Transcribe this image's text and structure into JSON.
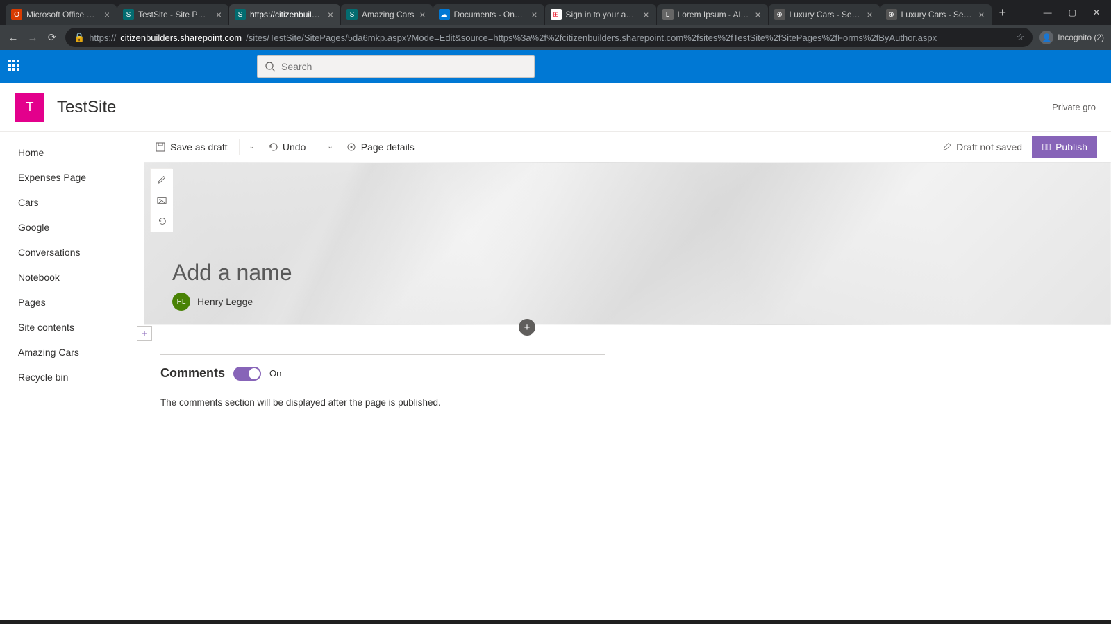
{
  "browser": {
    "tabs": [
      {
        "title": "Microsoft Office Home",
        "fav_bg": "#d83b01",
        "fav_txt": "O"
      },
      {
        "title": "TestSite - Site Pages -",
        "fav_bg": "#036c70",
        "fav_txt": "S"
      },
      {
        "title": "https://citizenbuilders",
        "fav_bg": "#036c70",
        "fav_txt": "S",
        "active": true
      },
      {
        "title": "Amazing Cars",
        "fav_bg": "#036c70",
        "fav_txt": "S"
      },
      {
        "title": "Documents - OneDriv",
        "fav_bg": "#0078d4",
        "fav_txt": "☁"
      },
      {
        "title": "Sign in to your accoun",
        "fav_bg": "#ffffff",
        "fav_txt": "⊞"
      },
      {
        "title": "Lorem Ipsum - All the",
        "fav_bg": "#666666",
        "fav_txt": "L"
      },
      {
        "title": "Luxury Cars - Sedans,",
        "fav_bg": "#555555",
        "fav_txt": "⊕"
      },
      {
        "title": "Luxury Cars - Sedans,",
        "fav_bg": "#555555",
        "fav_txt": "⊕"
      }
    ],
    "url_host": "citizenbuilders.sharepoint.com",
    "url_path": "/sites/TestSite/SitePages/5da6mkp.aspx?Mode=Edit&source=https%3a%2f%2fcitizenbuilders.sharepoint.com%2fsites%2fTestSite%2fSitePages%2fForms%2fByAuthor.aspx",
    "incognito_label": "Incognito (2)"
  },
  "suite": {
    "search_placeholder": "Search"
  },
  "site": {
    "logo_letter": "T",
    "name": "TestSite",
    "privacy": "Private gro"
  },
  "leftnav": {
    "items": [
      {
        "label": "Home"
      },
      {
        "label": "Expenses Page"
      },
      {
        "label": "Cars"
      },
      {
        "label": "Google"
      },
      {
        "label": "Conversations"
      },
      {
        "label": "Notebook"
      },
      {
        "label": "Pages"
      },
      {
        "label": "Site contents"
      },
      {
        "label": "Amazing Cars"
      },
      {
        "label": "Recycle bin"
      }
    ]
  },
  "cmdbar": {
    "save": "Save as draft",
    "undo": "Undo",
    "page_details": "Page details",
    "draft_status": "Draft not saved",
    "publish": "Publish"
  },
  "hero": {
    "title_placeholder": "Add a name",
    "author_initials": "HL",
    "author_name": "Henry Legge"
  },
  "comments": {
    "title": "Comments",
    "state_label": "On",
    "note": "The comments section will be displayed after the page is published."
  }
}
